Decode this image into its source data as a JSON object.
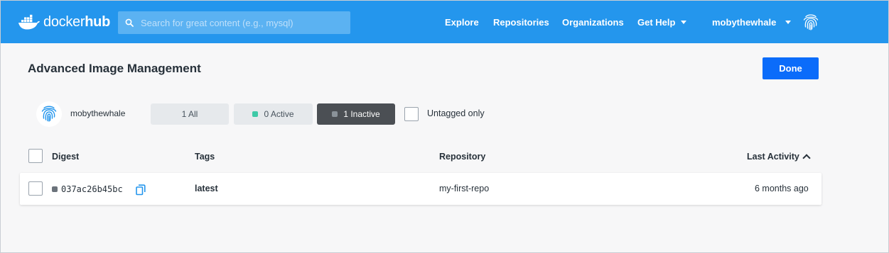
{
  "brand": {
    "name_prefix": "docker",
    "name_suffix": "hub",
    "logo_icon": "docker-whale-icon"
  },
  "colors": {
    "nav_background": "#2496ed",
    "primary_button": "#0b6cfa",
    "active_dot": "#3ec9a7",
    "inactive_dot": "#8a9299",
    "selected_filter": "#4b4f54"
  },
  "search": {
    "placeholder": "Search for great content (e.g., mysql)",
    "value": ""
  },
  "nav": {
    "explore": "Explore",
    "repositories": "Repositories",
    "organizations": "Organizations",
    "get_help": "Get Help"
  },
  "user": {
    "username": "mobythewhale"
  },
  "page": {
    "title": "Advanced Image Management",
    "done_label": "Done"
  },
  "owner": {
    "name": "mobythewhale"
  },
  "filters": {
    "all": "1 All",
    "active": "0 Active",
    "inactive": "1 Inactive",
    "selected": "inactive"
  },
  "untagged": {
    "label": "Untagged only",
    "checked": false
  },
  "table": {
    "columns": {
      "digest": "Digest",
      "tags": "Tags",
      "repository": "Repository",
      "last_activity": "Last Activity"
    },
    "rows": [
      {
        "digest": "037ac26b45bc",
        "tag": "latest",
        "repository": "my-first-repo",
        "last_activity": "6 months ago",
        "status": "inactive"
      }
    ]
  }
}
